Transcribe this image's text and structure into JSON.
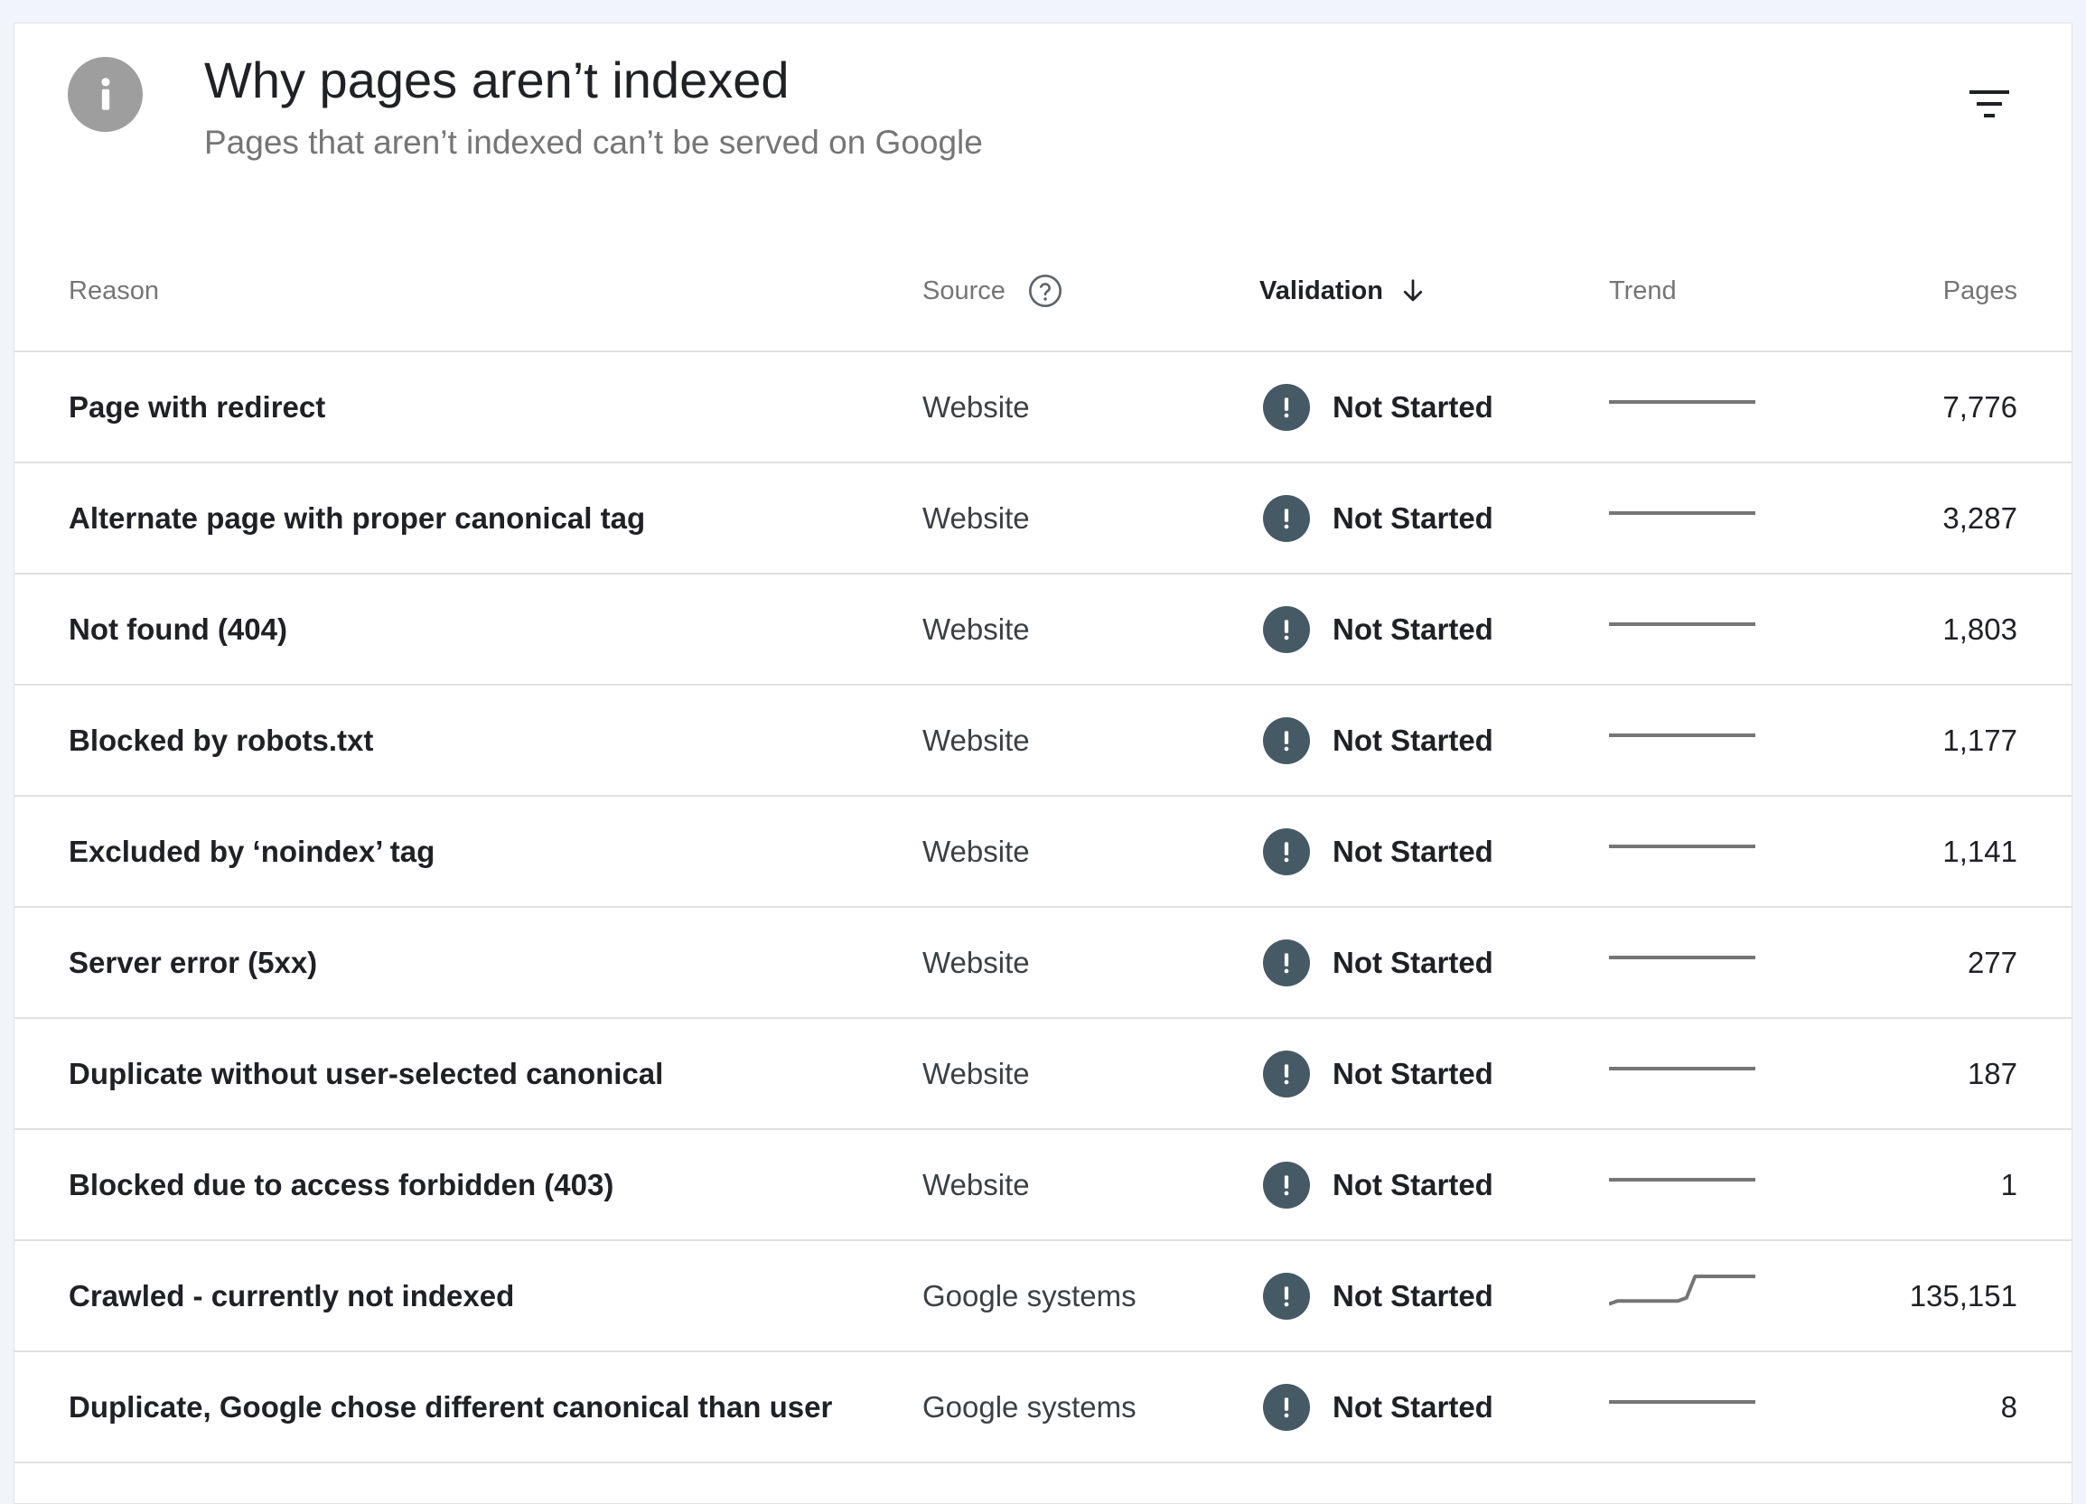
{
  "header": {
    "title": "Why pages aren’t indexed",
    "subtitle": "Pages that aren’t indexed can’t be served on Google"
  },
  "icons": {
    "info": "info-icon",
    "filter": "filter-icon",
    "help": "help-circle-icon",
    "sort": "arrow-down-icon",
    "status": "exclamation-circle-icon"
  },
  "colors": {
    "status_icon": "#455a64",
    "trend_line": "#757575"
  },
  "table": {
    "columns": {
      "reason": "Reason",
      "source": "Source",
      "validation": "Validation",
      "trend": "Trend",
      "pages": "Pages"
    },
    "sort": {
      "column": "Validation",
      "direction": "descending"
    },
    "rows": [
      {
        "reason": "Page with redirect",
        "source": "Website",
        "validation": "Not Started",
        "trend": [
          1,
          1,
          1,
          1,
          1,
          1
        ],
        "pages": "7,776"
      },
      {
        "reason": "Alternate page with proper canonical tag",
        "source": "Website",
        "validation": "Not Started",
        "trend": [
          1,
          1,
          1,
          1,
          1,
          1
        ],
        "pages": "3,287"
      },
      {
        "reason": "Not found (404)",
        "source": "Website",
        "validation": "Not Started",
        "trend": [
          1,
          1,
          1,
          1,
          1,
          1
        ],
        "pages": "1,803"
      },
      {
        "reason": "Blocked by robots.txt",
        "source": "Website",
        "validation": "Not Started",
        "trend": [
          1,
          1,
          1,
          1,
          1,
          1
        ],
        "pages": "1,177"
      },
      {
        "reason": "Excluded by ‘noindex’ tag",
        "source": "Website",
        "validation": "Not Started",
        "trend": [
          1,
          1,
          1,
          1,
          1,
          1
        ],
        "pages": "1,141"
      },
      {
        "reason": "Server error (5xx)",
        "source": "Website",
        "validation": "Not Started",
        "trend": [
          1,
          1,
          1,
          1,
          1,
          1
        ],
        "pages": "277"
      },
      {
        "reason": "Duplicate without user-selected canonical",
        "source": "Website",
        "validation": "Not Started",
        "trend": [
          1,
          1,
          1,
          1,
          1,
          1
        ],
        "pages": "187"
      },
      {
        "reason": "Blocked due to access forbidden (403)",
        "source": "Website",
        "validation": "Not Started",
        "trend": [
          1,
          1,
          1,
          1,
          1,
          1
        ],
        "pages": "1"
      },
      {
        "reason": "Crawled - currently not indexed",
        "source": "Google systems",
        "validation": "Not Started",
        "trend": [
          0.1,
          0.2,
          0.2,
          0.2,
          0.2,
          0.2,
          0.2,
          0.2,
          0.2,
          0.3,
          1,
          1,
          1,
          1,
          1,
          1,
          1,
          1
        ],
        "pages": "135,151"
      },
      {
        "reason": "Duplicate, Google chose different canonical than user",
        "source": "Google systems",
        "validation": "Not Started",
        "trend": [
          1,
          1,
          1,
          1,
          1,
          1
        ],
        "pages": "8"
      }
    ]
  }
}
